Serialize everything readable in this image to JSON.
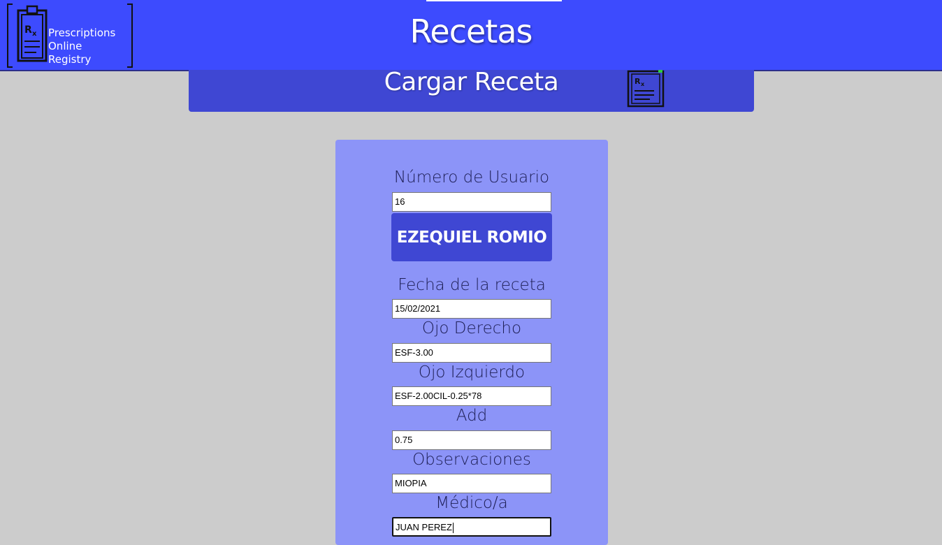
{
  "header": {
    "logo_lines": [
      "Prescriptions",
      "Online",
      "Registry"
    ],
    "title": "Recetas",
    "brand_color": "#3d4bfe"
  },
  "section": {
    "title": "Cargar Receta",
    "icon": "prescription-clipboard-icon"
  },
  "form": {
    "user_number": {
      "label": "Número de Usuario",
      "value": "16"
    },
    "user_button_label": "EZEQUIEL ROMIO",
    "date": {
      "label": "Fecha de la receta",
      "value": "15/02/2021"
    },
    "right_eye": {
      "label": "Ojo Derecho",
      "value": "ESF-3.00"
    },
    "left_eye": {
      "label": "Ojo Izquierdo",
      "value": "ESF-2.00CIL-0.25*78"
    },
    "add": {
      "label": "Add",
      "value": "0.75"
    },
    "observations": {
      "label": "Observaciones",
      "value": "MIOPIA"
    },
    "doctor": {
      "label": "Médico/a",
      "value": "JUAN PEREZ"
    }
  }
}
